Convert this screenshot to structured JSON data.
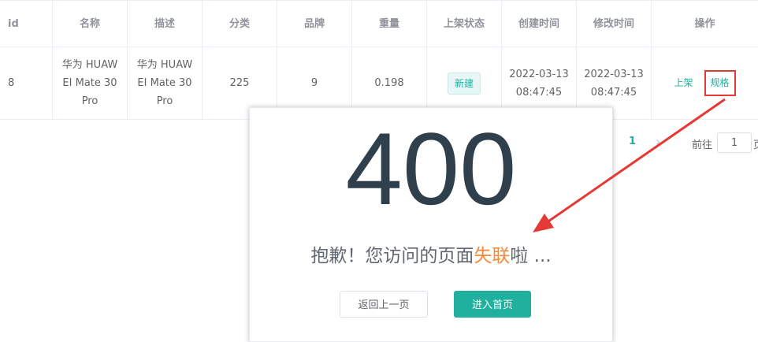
{
  "table": {
    "headers": [
      "id",
      "名称",
      "描述",
      "分类",
      "品牌",
      "重量",
      "上架状态",
      "创建时间",
      "修改时间",
      "操作"
    ],
    "rows": [
      {
        "id": "8",
        "name": "华为 HUAWEI Mate 30 Pro",
        "description": "华为 HUAWEI Mate 30 Pro",
        "category": "225",
        "brand": "9",
        "weight": "0.198",
        "status": "新建",
        "created": "2022-03-13 08:47:45",
        "modified": "2022-03-13 08:47:45",
        "actions": [
          "上架",
          "规格"
        ]
      }
    ]
  },
  "pagination": {
    "current_page": "1",
    "goto_label": "前往",
    "goto_value": "1",
    "page_suffix": "页"
  },
  "error_page": {
    "code": "400",
    "message_prefix": "抱歉！您访问的页面",
    "message_highlight": "失联",
    "message_suffix": "啦 ...",
    "back_button": "返回上一页",
    "home_button": "进入首页"
  },
  "colors": {
    "accent": "#1fb19e",
    "highlight": "#f6893b",
    "annotation": "#e53935",
    "code": "#2f3f4b"
  }
}
